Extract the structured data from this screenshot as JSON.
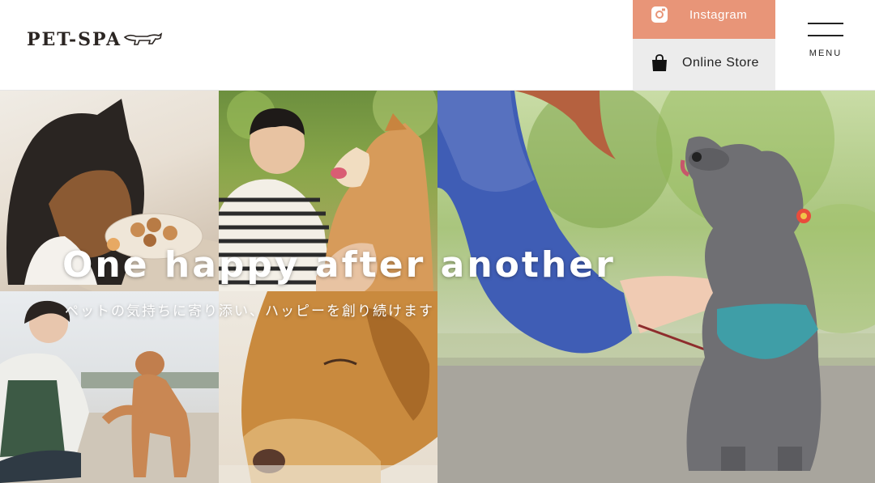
{
  "header": {
    "logo_text": "PET-SPA",
    "instagram_label": "Instagram",
    "online_store_label": "Online Store",
    "menu_label": "MENU"
  },
  "hero": {
    "headline": "One happy after another",
    "subline": "ペットの気持ちに寄り添い、ハッピーを創り続けます"
  },
  "colors": {
    "instagram_bg": "#e89578",
    "store_bg": "#ececec",
    "text_dark": "#222222"
  },
  "icons": {
    "instagram": "instagram-icon",
    "store": "shopping-bag-icon",
    "logo": "dog-logo-icon"
  }
}
